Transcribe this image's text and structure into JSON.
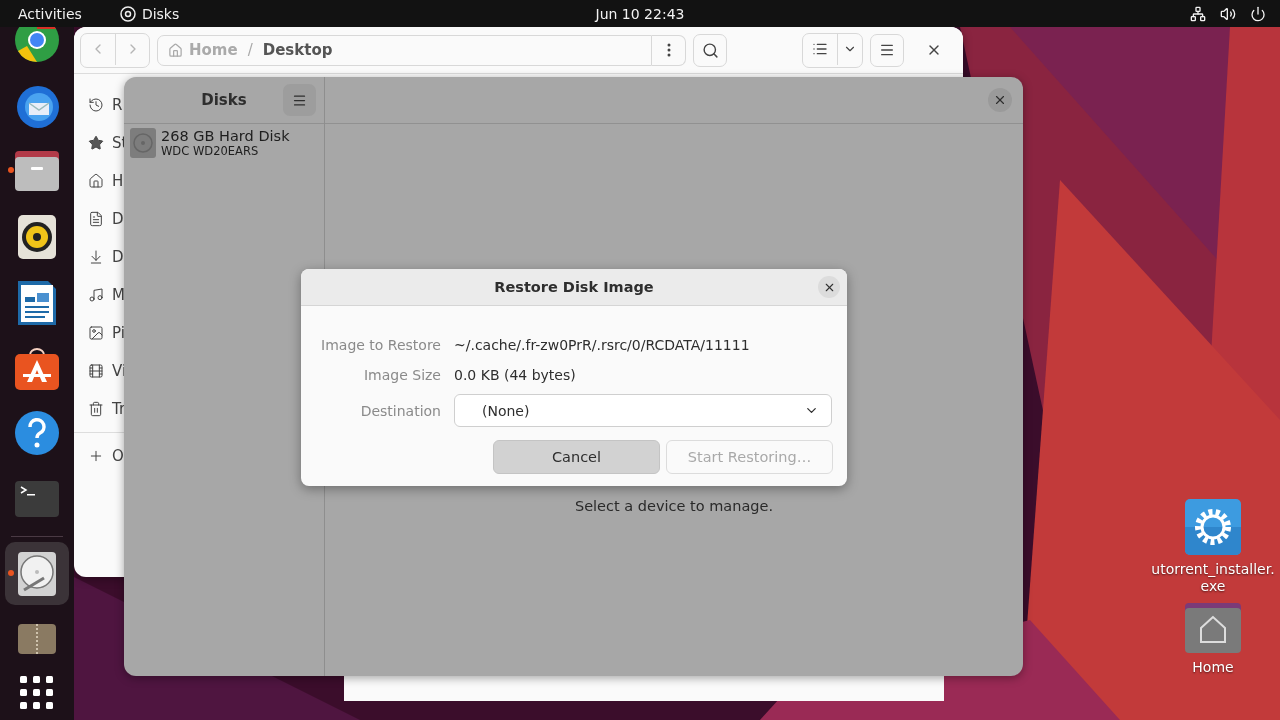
{
  "top_bar": {
    "activities": "Activities",
    "app_name": "Disks",
    "clock": "Jun 10  22:43"
  },
  "dock": [
    {
      "kind": "browser",
      "running": false,
      "selected": false
    },
    {
      "kind": "mail",
      "running": false,
      "selected": false
    },
    {
      "kind": "files",
      "running": true,
      "selected": false
    },
    {
      "kind": "music",
      "running": false,
      "selected": false
    },
    {
      "kind": "writer",
      "running": false,
      "selected": false
    },
    {
      "kind": "store",
      "running": false,
      "selected": false
    },
    {
      "kind": "help",
      "running": false,
      "selected": false
    },
    {
      "kind": "terminal",
      "running": false,
      "selected": false
    },
    {
      "kind": "disks",
      "running": true,
      "selected": true
    },
    {
      "kind": "archive",
      "running": false,
      "selected": false
    }
  ],
  "files_window": {
    "path": [
      {
        "label": "Home",
        "current": false
      },
      {
        "label": "Desktop",
        "current": true
      }
    ],
    "separator": "/",
    "sidebar": [
      {
        "label": "R",
        "kind": "recent"
      },
      {
        "label": "St",
        "kind": "starred"
      },
      {
        "label": "H",
        "kind": "home"
      },
      {
        "label": "D",
        "kind": "documents"
      },
      {
        "label": "D",
        "kind": "downloads"
      },
      {
        "label": "M",
        "kind": "music"
      },
      {
        "label": "Pi",
        "kind": "pictures"
      },
      {
        "label": "Vi",
        "kind": "videos"
      },
      {
        "label": "Tr",
        "kind": "trash"
      },
      {
        "label": "O",
        "kind": "other"
      }
    ]
  },
  "disks_window": {
    "title": "Disks",
    "devices": [
      {
        "name": "268 GB Hard Disk",
        "model": "WDC WD20EARS",
        "selected": false
      }
    ],
    "empty_message": "Select a device to manage."
  },
  "dialog": {
    "title": "Restore Disk Image",
    "fields": [
      {
        "label": "Image to Restore",
        "value": "~/.cache/.fr-zw0PrR/.rsrc/0/RCDATA/11111"
      },
      {
        "label": "Image Size",
        "value": "0.0 KB (44 bytes)"
      }
    ],
    "destination": {
      "label": "Destination",
      "value": "(None)"
    },
    "buttons": [
      {
        "label": "Cancel",
        "disabled": false
      },
      {
        "label": "Start Restoring…",
        "disabled": true
      }
    ]
  },
  "desktop_icons": [
    {
      "label": "utorrent_installer.exe",
      "kind": "installer"
    },
    {
      "label": "Home",
      "kind": "home"
    }
  ]
}
